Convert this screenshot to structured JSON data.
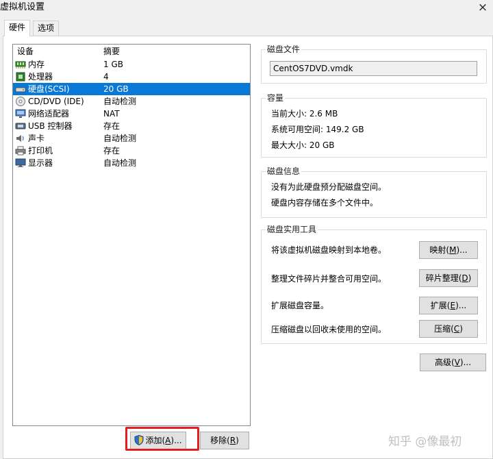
{
  "window": {
    "title": "虚拟机设置",
    "close_glyph": "×"
  },
  "tabs": [
    {
      "label": "硬件",
      "active": true
    },
    {
      "label": "选项",
      "active": false
    }
  ],
  "device_list": {
    "header": {
      "device": "设备",
      "summary": "摘要"
    },
    "devices": [
      {
        "icon": "memory-icon",
        "name": "内存",
        "summary": "1 GB"
      },
      {
        "icon": "processor-icon",
        "name": "处理器",
        "summary": "4"
      },
      {
        "icon": "hard-disk-icon",
        "name": "硬盘(SCSI)",
        "summary": "20 GB",
        "selected": true
      },
      {
        "icon": "cd-dvd-icon",
        "name": "CD/DVD (IDE)",
        "summary": "自动检测"
      },
      {
        "icon": "network-adapter-icon",
        "name": "网络适配器",
        "summary": "NAT"
      },
      {
        "icon": "usb-controller-icon",
        "name": "USB 控制器",
        "summary": "存在"
      },
      {
        "icon": "sound-card-icon",
        "name": "声卡",
        "summary": "自动检测"
      },
      {
        "icon": "printer-icon",
        "name": "打印机",
        "summary": "存在"
      },
      {
        "icon": "display-icon",
        "name": "显示器",
        "summary": "自动检测"
      }
    ]
  },
  "buttons": {
    "add_label": "添加(A)...",
    "add_prefix": "添加(",
    "add_key": "A",
    "add_suffix": ")...",
    "remove_prefix": "移除(",
    "remove_key": "R",
    "remove_suffix": ")",
    "advanced_prefix": "高级(",
    "advanced_key": "V",
    "advanced_suffix": ")..."
  },
  "disk_file": {
    "title": "磁盘文件",
    "value": "CentOS7DVD.vmdk"
  },
  "capacity": {
    "title": "容量",
    "current_size": "当前大小: 2.6 MB",
    "system_available": "系统可用空间: 149.2 GB",
    "max_size": "最大大小: 20 GB"
  },
  "disk_info": {
    "title": "磁盘信息",
    "line1": "没有为此硬盘预分配磁盘空间。",
    "line2": "硬盘内容存储在多个文件中。"
  },
  "disk_utilities": {
    "title": "磁盘实用工具",
    "tools": [
      {
        "description": "将该虚拟机磁盘映射到本地卷。",
        "prefix": "映射(",
        "key": "M",
        "suffix": ")..."
      },
      {
        "description": "整理文件碎片并整合可用空间。",
        "prefix": "碎片整理(",
        "key": "D",
        "suffix": ")"
      },
      {
        "description": "扩展磁盘容量。",
        "prefix": "扩展(",
        "key": "E",
        "suffix": ")..."
      },
      {
        "description": "压缩磁盘以回收未使用的空间。",
        "prefix": "压缩(",
        "key": "C",
        "suffix": ")"
      }
    ]
  },
  "watermark": "知乎 @像最初",
  "colors": {
    "selection": "#0a78d7",
    "highlight_box": "#e02020"
  }
}
